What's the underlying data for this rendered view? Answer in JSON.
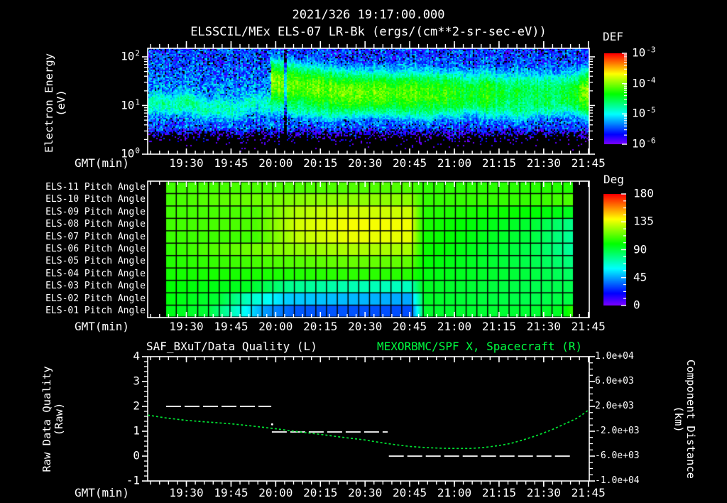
{
  "title": {
    "line1": "2021/326 19:17:00.000",
    "line2": "ELSSCIL/MEx ELS-07 LR-Bk  (ergs/(cm**2-sr-sec-eV))"
  },
  "colors": {
    "background": "#000000",
    "text": "#ffffff",
    "accent_green": "#00ff41",
    "curve_green": "#00e533",
    "frame_white": "#ffffff",
    "grid_black": "#000000"
  },
  "time_axis": {
    "label": "GMT(min)",
    "start_time": "19:17:00.000",
    "labels": [
      "19:30",
      "19:45",
      "20:00",
      "20:15",
      "20:30",
      "20:45",
      "21:00",
      "21:15",
      "21:30",
      "21:45"
    ],
    "first_tick_min": 13,
    "interval_min": 15,
    "minor_min": 3,
    "total_min": 148.3
  },
  "axis_titles": {
    "energy": {
      "line1": "Electron Energy",
      "line2": "(eV)"
    },
    "raw": {
      "line1": "Raw Data Quality",
      "line2": "(Raw)"
    },
    "distance": {
      "line1": "Component Distance",
      "line2": "(km)"
    }
  },
  "chart_data": [
    {
      "type": "heatmap",
      "name": "electron-energy-spectrogram",
      "title": "ELSSCIL/MEx ELS-07 LR-Bk  (ergs/(cm**2-sr-sec-eV))",
      "y_axis": {
        "label": "Electron Energy (eV)",
        "scale": "log",
        "range_ev": [
          1,
          150
        ],
        "ticks": [
          {
            "b": "10",
            "e": "2"
          },
          {
            "b": "10",
            "e": "1"
          },
          {
            "b": "10",
            "e": "0"
          }
        ]
      },
      "colorbar": {
        "title": "DEF",
        "units": "ergs/(cm**2-sr-sec-eV)",
        "scale": "log",
        "colormap": "rainbow",
        "ticks": [
          {
            "b": "10",
            "e": "-3"
          },
          {
            "b": "10",
            "e": "-4"
          },
          {
            "b": "10",
            "e": "-5"
          },
          {
            "b": "10",
            "e": "-6"
          }
        ]
      },
      "model": {
        "background": {
          "log_flux_base": -6.35,
          "noise_decades": 0.85,
          "mid_bump": {
            "center_log_e": 1.2,
            "sigma": 0.5,
            "amp": 0.3
          },
          "bottom_cut_log_e": 0.55
        },
        "cyan_band": {
          "flux": 6e-06,
          "center_log_e": 1.0,
          "sigma": 0.17,
          "wiggle": 0.06
        },
        "main_band": {
          "onset_min": 41.5,
          "flux": 6e-05,
          "center_log_e_start": 1.5,
          "center_log_e_end": 1.28,
          "sigma": 0.27
        },
        "gap_min": [
          45.8,
          46.6
        ],
        "intensity_profile": [
          [
            41.5,
            1.5
          ],
          [
            43,
            1.35
          ],
          [
            45.5,
            1.05
          ],
          [
            46.2,
            0.3
          ],
          [
            47,
            1.05
          ],
          [
            52,
            0.95
          ],
          [
            60,
            1.0
          ],
          [
            68,
            1.05
          ],
          [
            75,
            0.95
          ],
          [
            80,
            0.85
          ],
          [
            88,
            0.8
          ],
          [
            95,
            0.7
          ],
          [
            100,
            0.6
          ],
          [
            104,
            0.4
          ],
          [
            108,
            0.35
          ],
          [
            112,
            0.45
          ],
          [
            114.5,
            0.7
          ],
          [
            117,
            0.22
          ],
          [
            119,
            0.45
          ],
          [
            121,
            0.2
          ],
          [
            124,
            0.3
          ],
          [
            128,
            0.25
          ],
          [
            133,
            0.3
          ],
          [
            137,
            0.25
          ],
          [
            141,
            0.28
          ],
          [
            144,
            0.35
          ],
          [
            145.8,
            1.1
          ],
          [
            148.3,
            1.2
          ]
        ]
      }
    },
    {
      "type": "heatmap",
      "name": "pitch-angle-grid",
      "row_labels": [
        "ELS-11 Pitch Angle",
        "ELS-10 Pitch Angle",
        "ELS-09 Pitch Angle",
        "ELS-08 Pitch Angle",
        "ELS-07 Pitch Angle",
        "ELS-06 Pitch Angle",
        "ELS-05 Pitch Angle",
        "ELS-04 Pitch Angle",
        "ELS-03 Pitch Angle",
        "ELS-02 Pitch Angle",
        "ELS-01 Pitch Angle"
      ],
      "colorbar": {
        "title": "Deg",
        "ticks": [
          180,
          135,
          90,
          45,
          0
        ],
        "colormap": "rainbow",
        "range": [
          0,
          180
        ]
      },
      "units": "degrees",
      "data_start_min": 6,
      "data_end_min": 143,
      "n_columns": 38,
      "row_keyframes": [
        [
          [
            0,
            110
          ],
          [
            0.26,
            112
          ],
          [
            0.6,
            113
          ],
          [
            0.63,
            107
          ],
          [
            0.9,
            106
          ],
          [
            1,
            105
          ]
        ],
        [
          [
            0,
            110
          ],
          [
            0.26,
            118
          ],
          [
            0.35,
            122
          ],
          [
            0.6,
            122
          ],
          [
            0.63,
            108
          ],
          [
            0.9,
            108
          ],
          [
            1,
            112
          ]
        ],
        [
          [
            0,
            110
          ],
          [
            0.22,
            112
          ],
          [
            0.32,
            128
          ],
          [
            0.42,
            133
          ],
          [
            0.6,
            132
          ],
          [
            0.63,
            106
          ],
          [
            0.9,
            100
          ],
          [
            1,
            95
          ]
        ],
        [
          [
            0,
            110
          ],
          [
            0.22,
            112
          ],
          [
            0.32,
            133
          ],
          [
            0.45,
            139
          ],
          [
            0.6,
            138
          ],
          [
            0.63,
            104
          ],
          [
            0.9,
            92
          ],
          [
            1,
            78
          ]
        ],
        [
          [
            0,
            109
          ],
          [
            0.22,
            110
          ],
          [
            0.32,
            130
          ],
          [
            0.45,
            137
          ],
          [
            0.6,
            136
          ],
          [
            0.63,
            103
          ],
          [
            0.9,
            90
          ],
          [
            1,
            75
          ]
        ],
        [
          [
            0,
            107
          ],
          [
            0.26,
            120
          ],
          [
            0.45,
            127
          ],
          [
            0.6,
            126
          ],
          [
            0.63,
            102
          ],
          [
            0.9,
            88
          ],
          [
            1,
            75
          ]
        ],
        [
          [
            0,
            105
          ],
          [
            0.26,
            112
          ],
          [
            0.45,
            116
          ],
          [
            0.6,
            115
          ],
          [
            0.63,
            100
          ],
          [
            0.9,
            88
          ],
          [
            1,
            80
          ]
        ],
        [
          [
            0,
            103
          ],
          [
            0.26,
            104
          ],
          [
            0.45,
            107
          ],
          [
            0.6,
            106
          ],
          [
            0.63,
            98
          ],
          [
            0.9,
            90
          ],
          [
            1,
            84
          ]
        ],
        [
          [
            0,
            100
          ],
          [
            0.2,
            95
          ],
          [
            0.3,
            78
          ],
          [
            0.45,
            72
          ],
          [
            0.6,
            70
          ],
          [
            0.63,
            95
          ],
          [
            0.9,
            88
          ],
          [
            1,
            88
          ]
        ],
        [
          [
            0,
            99
          ],
          [
            0.13,
            92
          ],
          [
            0.2,
            70
          ],
          [
            0.3,
            52
          ],
          [
            0.6,
            46
          ],
          [
            0.635,
            94
          ],
          [
            0.9,
            88
          ],
          [
            1,
            90
          ]
        ],
        [
          [
            0,
            97
          ],
          [
            0.1,
            92
          ],
          [
            0.16,
            72
          ],
          [
            0.24,
            45
          ],
          [
            0.32,
            34
          ],
          [
            0.6,
            32
          ],
          [
            0.635,
            93
          ],
          [
            0.9,
            92
          ],
          [
            0.97,
            95
          ],
          [
            1,
            108
          ]
        ]
      ]
    },
    {
      "type": "line",
      "name": "quality-and-distance",
      "left": {
        "title": "SAF_BXuT/Data Quality (L)",
        "axis_ticks": [
          4,
          3,
          2,
          1,
          0,
          -1
        ],
        "range": [
          -1,
          4
        ],
        "segments": [
          {
            "t0": 6.2,
            "t1": 41.5,
            "value": 2.0
          },
          {
            "t0": 41.7,
            "t1": 80.6,
            "value": 0.97
          },
          {
            "t0": 81.0,
            "t1": 142.8,
            "value": 0.0
          }
        ],
        "dot": {
          "t": 41.8,
          "value": 1.28
        }
      },
      "right": {
        "title": "MEXORBMC/SPF X, Spacecraft (R)",
        "axis_ticks": [
          "1.0e+04",
          "6.0e+03",
          "2.0e+03",
          "-2.0e+03",
          "-6.0e+03",
          "-1.0e+04"
        ],
        "range": [
          -10000,
          10000
        ],
        "series": [
          [
            0,
            600
          ],
          [
            6,
            150
          ],
          [
            13,
            -250
          ],
          [
            20,
            -520
          ],
          [
            28,
            -800
          ],
          [
            35,
            -1150
          ],
          [
            43,
            -1600
          ],
          [
            50,
            -2050
          ],
          [
            58,
            -2500
          ],
          [
            65,
            -2950
          ],
          [
            73,
            -3400
          ],
          [
            78,
            -3800
          ],
          [
            83,
            -4150
          ],
          [
            88,
            -4450
          ],
          [
            93,
            -4620
          ],
          [
            98,
            -4720
          ],
          [
            103,
            -4770
          ],
          [
            108,
            -4780
          ],
          [
            113,
            -4620
          ],
          [
            118,
            -4300
          ],
          [
            122,
            -3950
          ],
          [
            126,
            -3400
          ],
          [
            130,
            -2800
          ],
          [
            133,
            -2270
          ],
          [
            136,
            -1700
          ],
          [
            139,
            -1050
          ],
          [
            142,
            -400
          ],
          [
            144,
            50
          ],
          [
            146,
            700
          ],
          [
            148,
            1400
          ]
        ]
      }
    }
  ]
}
